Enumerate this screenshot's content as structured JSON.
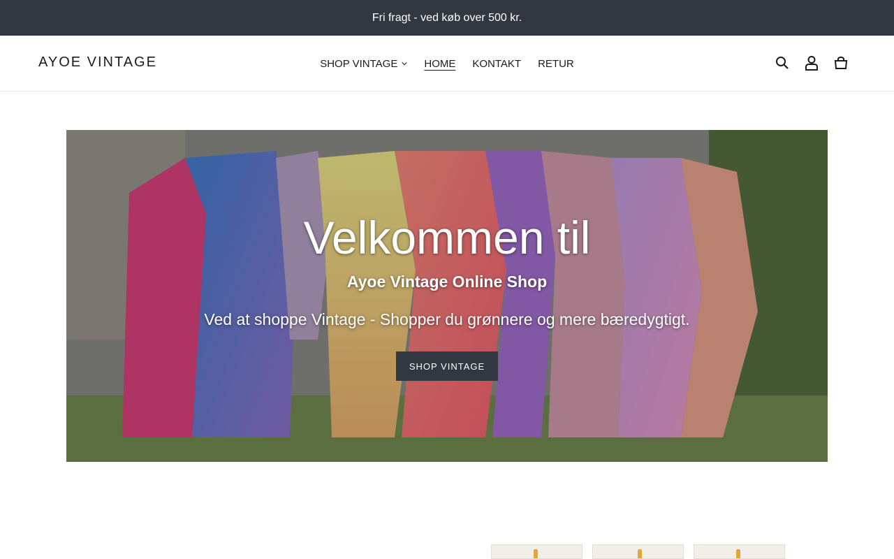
{
  "announcement": "Fri fragt - ved køb over 500 kr.",
  "header": {
    "logo": "AYOE VINTAGE",
    "nav": [
      {
        "label": "SHOP VINTAGE",
        "has_dropdown": true
      },
      {
        "label": "HOME",
        "active": true
      },
      {
        "label": "KONTAKT"
      },
      {
        "label": "RETUR"
      }
    ],
    "icons": [
      "search-icon",
      "account-icon",
      "cart-icon"
    ]
  },
  "hero": {
    "title": "Velkommen til",
    "subtitle": "Ayoe Vintage Online Shop",
    "description": "Ved at shoppe Vintage - Shopper du grønnere og mere bæredygtigt.",
    "button": "SHOP VINTAGE"
  },
  "colors": {
    "dark": "#323841",
    "text": "#1b1b1b",
    "white": "#ffffff"
  }
}
